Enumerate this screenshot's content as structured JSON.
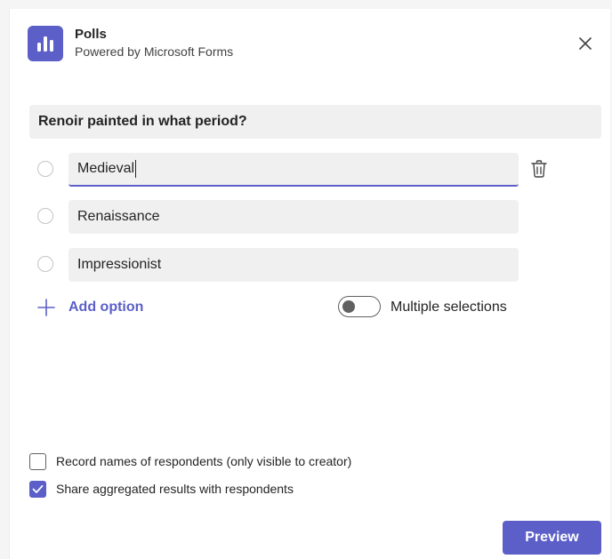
{
  "header": {
    "title": "Polls",
    "subtitle": "Powered by Microsoft Forms",
    "app_icon": "poll-chart-icon",
    "close_icon": "close-icon"
  },
  "question": {
    "text": "Renoir painted in what period?"
  },
  "options": [
    {
      "value": "Medieval",
      "focused": true
    },
    {
      "value": "Renaissance",
      "focused": false
    },
    {
      "value": "Impressionist",
      "focused": false
    }
  ],
  "add_option": {
    "label": "Add option",
    "icon": "plus-icon"
  },
  "multiple_selections": {
    "label": "Multiple selections",
    "enabled": false
  },
  "settings": {
    "record_names": {
      "label": "Record names of respondents (only visible to creator)",
      "checked": false
    },
    "share_results": {
      "label": "Share aggregated results with respondents",
      "checked": true
    }
  },
  "footer": {
    "preview_label": "Preview"
  },
  "colors": {
    "accent": "#5b5fc7",
    "field_bg": "#f0f0f0"
  }
}
